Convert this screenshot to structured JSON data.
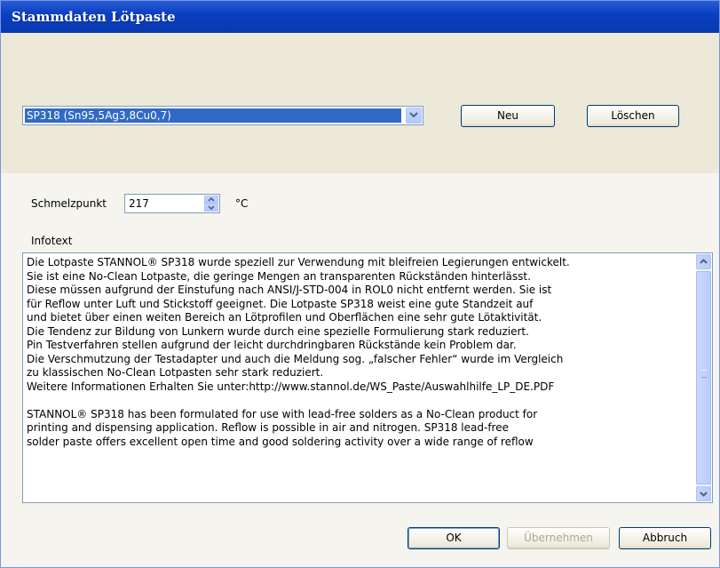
{
  "window": {
    "title": "Stammdaten Lötpaste"
  },
  "selector": {
    "selected": "SP318 (Sn95,5Ag3,8Cu0,7)",
    "new_label": "Neu",
    "delete_label": "Löschen"
  },
  "melting": {
    "label": "Schmelzpunkt",
    "value": "217",
    "unit": "°C"
  },
  "info": {
    "label": "Infotext",
    "lines": [
      "Die Lotpaste STANNOL® SP318 wurde speziell zur Verwendung mit bleifreien Legierungen entwickelt.",
      "Sie ist eine No-Clean Lotpaste, die geringe Mengen an transparenten Rückständen hinterlässt.",
      "Diese müssen aufgrund der Einstufung nach ANSI/J-STD-004 in ROL0 nicht entfernt werden. Sie ist",
      "für Reflow unter Luft und Stickstoff geeignet. Die Lotpaste SP318 weist eine gute Standzeit auf",
      "und bietet über einen weiten Bereich an Lötprofilen und Oberflächen eine sehr gute Lötaktivität.",
      "Die Tendenz zur Bildung von Lunkern wurde durch eine spezielle Formulierung stark reduziert.",
      "Pin Testverfahren stellen aufgrund der leicht durchdringbaren Rückstände kein Problem dar.",
      "Die Verschmutzung der Testadapter und auch die Meldung sog. „falscher Fehler“ wurde im Vergleich",
      "zu klassischen No-Clean Lotpasten sehr stark reduziert.",
      "Weitere Informationen Erhalten Sie unter:http://www.stannol.de/WS_Paste/Auswahlhilfe_LP_DE.PDF",
      "",
      "STANNOL® SP318 has been formulated for use with lead-free solders as a No-Clean product for",
      "printing and dispensing application. Reflow is possible in air and nitrogen. SP318 lead-free",
      "solder paste offers excellent open time and good soldering activity over a wide range of reflow"
    ]
  },
  "footer": {
    "ok_label": "OK",
    "apply_label": "Übernehmen",
    "cancel_label": "Abbruch"
  }
}
